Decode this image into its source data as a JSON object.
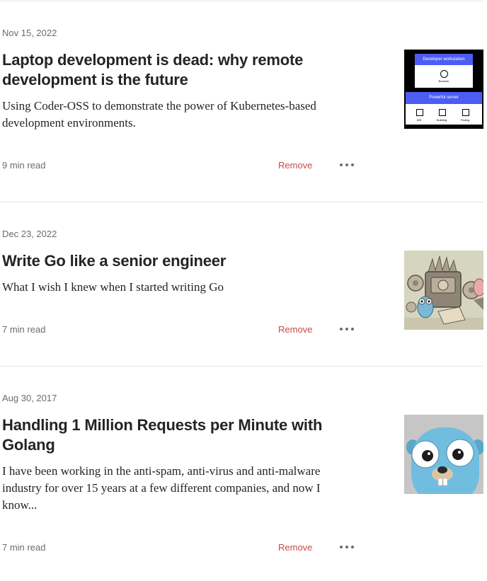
{
  "articles": [
    {
      "date": "Nov 15, 2022",
      "title": "Laptop development is dead: why remote development is the future",
      "subtitle": "Using Coder-OSS to demonstrate the power of Kubernetes-based development environments.",
      "read_time": "9 min read",
      "remove_label": "Remove",
      "thumbnail": {
        "header": "Developer workstation",
        "browser_label": "Browser",
        "server_label": "Powerful server",
        "items": [
          "IDE",
          "Building",
          "Testing"
        ]
      }
    },
    {
      "date": "Dec 23, 2022",
      "title": "Write Go like a senior engineer",
      "subtitle": "What I wish I knew when I started writing Go",
      "read_time": "7 min read",
      "remove_label": "Remove"
    },
    {
      "date": "Aug 30, 2017",
      "title": "Handling 1 Million Requests per Minute with Golang",
      "subtitle": "I have been working in the anti-spam, anti-virus and anti-malware industry for over 15 years at a few different companies, and now I know...",
      "read_time": "7 min read",
      "remove_label": "Remove"
    }
  ],
  "colors": {
    "remove": "#c94a4a",
    "meta": "#6b6b6b",
    "divider": "#e6e6e6",
    "thumbnail_accent": "#4d5df3"
  },
  "icons": {
    "more": "more-horizontal-icon",
    "globe": "globe-icon"
  }
}
